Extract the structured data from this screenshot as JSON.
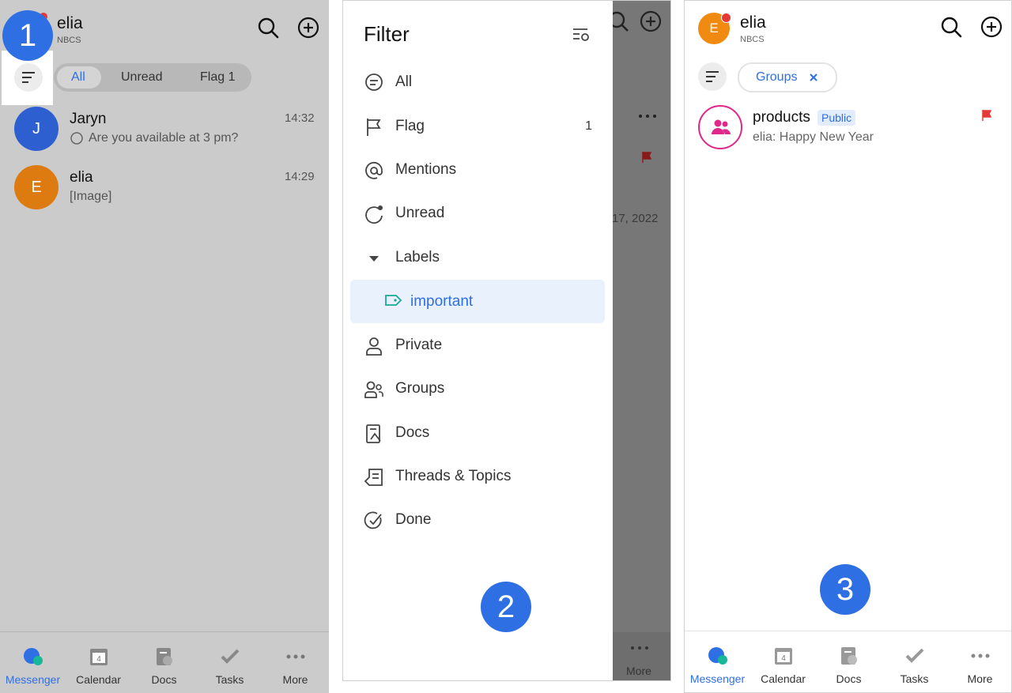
{
  "panel1": {
    "user": {
      "name": "elia",
      "org": "NBCS"
    },
    "step": "1",
    "segments": [
      "All",
      "Unread",
      "Flag 1"
    ],
    "chats": [
      {
        "initial": "J",
        "name": "Jaryn",
        "time": "14:32",
        "preview": "Are you available at 3 pm?",
        "color": "#2d5fd0"
      },
      {
        "initial": "E",
        "name": "elia",
        "time": "14:29",
        "preview": "[Image]",
        "color": "#dd7a10"
      }
    ]
  },
  "panel2": {
    "step": "2",
    "title": "Filter",
    "items": [
      {
        "icon": "chat-bubble-icon",
        "label": "All",
        "count": ""
      },
      {
        "icon": "flag-icon",
        "label": "Flag",
        "count": "1"
      },
      {
        "icon": "at-sign-icon",
        "label": "Mentions",
        "count": ""
      },
      {
        "icon": "unread-icon",
        "label": "Unread",
        "count": ""
      },
      {
        "icon": "caret-down-icon",
        "label": "Labels",
        "count": ""
      },
      {
        "icon": "tag-icon",
        "label": "important",
        "count": ""
      },
      {
        "icon": "person-icon",
        "label": "Private",
        "count": ""
      },
      {
        "icon": "people-icon",
        "label": "Groups",
        "count": ""
      },
      {
        "icon": "document-icon",
        "label": "Docs",
        "count": ""
      },
      {
        "icon": "threads-icon",
        "label": "Threads & Topics",
        "count": ""
      },
      {
        "icon": "check-circle-icon",
        "label": "Done",
        "count": ""
      }
    ],
    "background": {
      "date": "17, 2022",
      "more_label": "More"
    }
  },
  "panel3": {
    "step": "3",
    "user": {
      "initial": "E",
      "name": "elia",
      "org": "NBCS"
    },
    "active_filter": "Groups",
    "chat": {
      "name": "products",
      "badge": "Public",
      "preview": "elia: Happy New Year"
    }
  },
  "tabs": [
    "Messenger",
    "Calendar",
    "Docs",
    "Tasks",
    "More"
  ],
  "calendar_day": "4",
  "colors": {
    "accent": "#2f6fe4",
    "selected_bg": "#e9f1fd",
    "group_pink": "#e0288a",
    "flag_red": "#e53935",
    "tag_teal": "#1aa89a"
  }
}
